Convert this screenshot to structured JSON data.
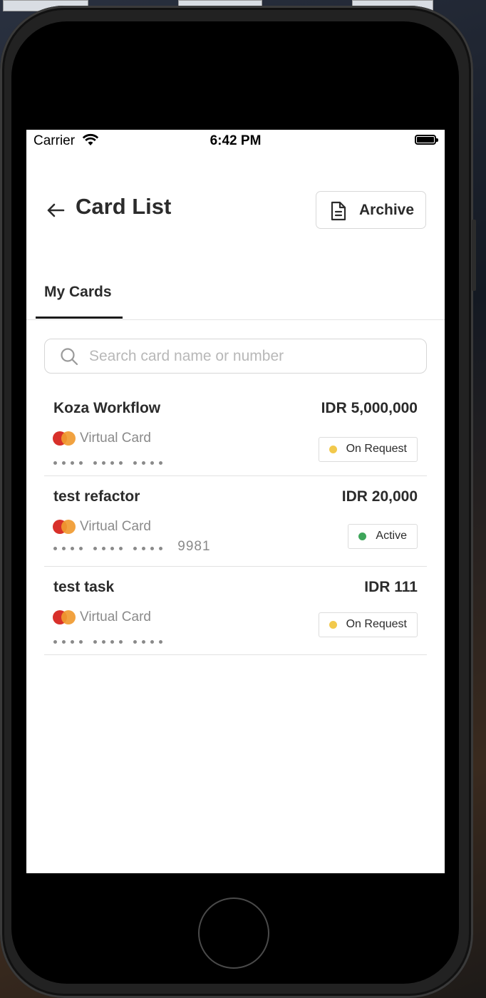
{
  "status_bar": {
    "carrier": "Carrier",
    "time": "6:42 PM"
  },
  "header": {
    "title": "Card List",
    "archive_label": "Archive"
  },
  "tabs": [
    {
      "label": "My Cards",
      "active": true
    }
  ],
  "search": {
    "placeholder": "Search card name or number",
    "value": ""
  },
  "cards": [
    {
      "name": "Koza Workflow",
      "amount": "IDR 5,000,000",
      "type": "Virtual Card",
      "last4": "",
      "status": "On Request",
      "status_color": "#f2c94c"
    },
    {
      "name": "test refactor",
      "amount": "IDR 20,000",
      "type": "Virtual Card",
      "last4": "9981",
      "status": "Active",
      "status_color": "#3ea55a"
    },
    {
      "name": "test task",
      "amount": "IDR 111",
      "type": "Virtual Card",
      "last4": "",
      "status": "On Request",
      "status_color": "#f2c94c"
    }
  ],
  "icons": {
    "back": "arrow-left-icon",
    "archive": "document-icon",
    "search": "search-icon",
    "wifi": "wifi-icon",
    "battery": "battery-icon",
    "card_brand": "mastercard-logo"
  }
}
